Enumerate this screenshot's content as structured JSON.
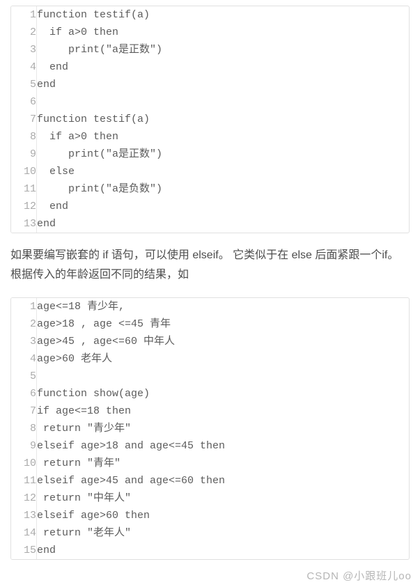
{
  "codeblock1": {
    "lines": [
      "function testif(a)",
      "  if a>0 then",
      "     print(\"a是正数\")",
      "  end",
      "end",
      "",
      "function testif(a)",
      "  if a>0 then",
      "     print(\"a是正数\")",
      "  else",
      "     print(\"a是负数\")",
      "  end",
      "end"
    ]
  },
  "paragraph1": "如果要编写嵌套的 if 语句，可以使用 elseif。 它类似于在 else 后面紧跟一个if。根据传入的年龄返回不同的结果，如",
  "codeblock2": {
    "lines": [
      "age<=18 青少年,",
      "age>18 , age <=45 青年",
      "age>45 , age<=60 中年人",
      "age>60 老年人",
      "",
      "function show(age)",
      "if age<=18 then",
      " return \"青少年\"",
      "elseif age>18 and age<=45 then",
      " return \"青年\"",
      "elseif age>45 and age<=60 then",
      " return \"中年人\"",
      "elseif age>60 then",
      " return \"老年人\"",
      "end"
    ]
  },
  "watermark": "CSDN @小跟班儿oo"
}
